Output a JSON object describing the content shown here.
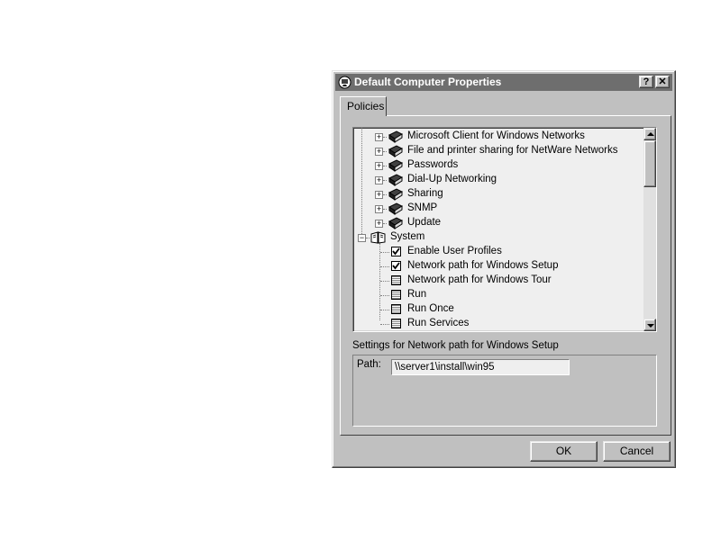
{
  "window": {
    "title": "Default Computer Properties",
    "help_label": "?",
    "close_label": "✕"
  },
  "tabs": [
    {
      "label": "Policies",
      "selected": true
    }
  ],
  "tree": {
    "items": [
      {
        "label": "Microsoft Client for Windows Networks",
        "type": "category",
        "expanded": false
      },
      {
        "label": "File and printer sharing for NetWare Networks",
        "type": "category",
        "expanded": false
      },
      {
        "label": "Passwords",
        "type": "category",
        "expanded": false
      },
      {
        "label": "Dial-Up Networking",
        "type": "category",
        "expanded": false
      },
      {
        "label": "Sharing",
        "type": "category",
        "expanded": false
      },
      {
        "label": "SNMP",
        "type": "category",
        "expanded": false
      },
      {
        "label": "Update",
        "type": "category",
        "expanded": false
      },
      {
        "label": "System",
        "type": "category-root",
        "expanded": true
      },
      {
        "label": "Enable User Profiles",
        "type": "policy",
        "state": "checked"
      },
      {
        "label": "Network path for Windows Setup",
        "type": "policy",
        "state": "checked"
      },
      {
        "label": "Network path for Windows Tour",
        "type": "policy",
        "state": "grayed"
      },
      {
        "label": "Run",
        "type": "policy",
        "state": "grayed"
      },
      {
        "label": "Run Once",
        "type": "policy",
        "state": "grayed"
      },
      {
        "label": "Run Services",
        "type": "policy",
        "state": "grayed"
      }
    ],
    "expand_glyph": "+",
    "collapse_glyph": "−"
  },
  "settings": {
    "label": "Settings for Network path for Windows Setup",
    "path_label": "Path:",
    "path_value": "\\\\server1\\install\\win95"
  },
  "buttons": {
    "ok": "OK",
    "cancel": "Cancel"
  },
  "colors": {
    "titlebar": "#6e6e6e",
    "face": "#c0c0c0",
    "tree_bg": "#efefef"
  }
}
